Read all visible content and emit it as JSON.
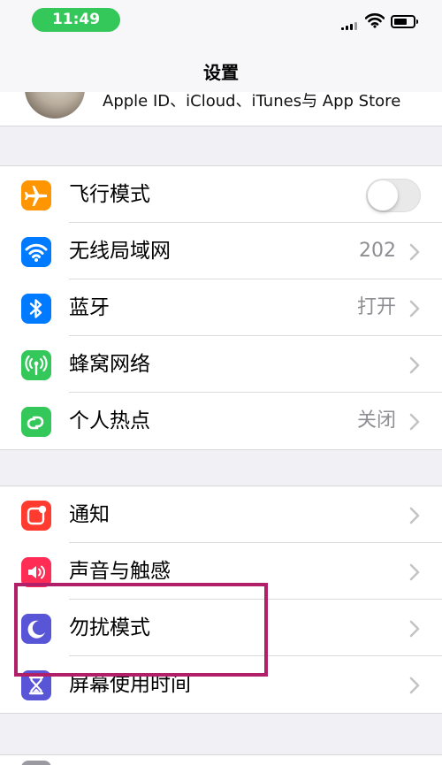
{
  "status_bar": {
    "time": "11:49",
    "time_pill_color": "#34c759",
    "icons": [
      "signal-icon",
      "wifi-icon",
      "battery-icon"
    ]
  },
  "nav": {
    "title": "设置"
  },
  "profile": {
    "subtitle": "Apple ID、iCloud、iTunes与 App Store"
  },
  "group1": {
    "items": [
      {
        "label": "飞行模式",
        "icon": "airplane-icon",
        "icon_color": "#ff9500",
        "toggle_on": false
      },
      {
        "label": "无线局域网",
        "icon": "wifi-icon",
        "icon_color": "#007aff",
        "value": "202"
      },
      {
        "label": "蓝牙",
        "icon": "bluetooth-icon",
        "icon_color": "#007aff",
        "value": "打开"
      },
      {
        "label": "蜂窝网络",
        "icon": "cellular-icon",
        "icon_color": "#34c759",
        "value": ""
      },
      {
        "label": "个人热点",
        "icon": "hotspot-icon",
        "icon_color": "#34c759",
        "value": "关闭"
      }
    ]
  },
  "group2": {
    "items": [
      {
        "label": "通知",
        "icon": "notifications-icon",
        "icon_color": "#ff3b30"
      },
      {
        "label": "声音与触感",
        "icon": "sounds-icon",
        "icon_color": "#ff2d55"
      },
      {
        "label": "勿扰模式",
        "icon": "moon-icon",
        "icon_color": "#5856d6"
      },
      {
        "label": "屏幕使用时间",
        "icon": "hourglass-icon",
        "icon_color": "#5856d6"
      }
    ]
  },
  "annotation_color": "#b01f68"
}
